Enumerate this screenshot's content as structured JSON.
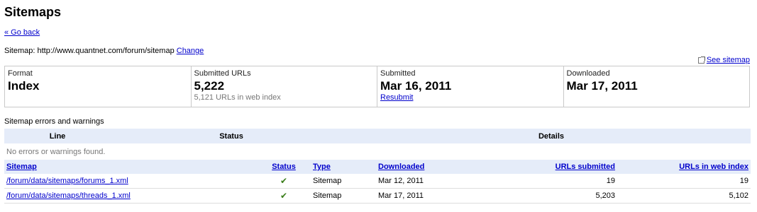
{
  "page": {
    "title": "Sitemaps",
    "go_back": "« Go back",
    "sitemap_label": "Sitemap:",
    "sitemap_url": "http://www.quantnet.com/forum/sitemap",
    "change_link": "Change",
    "see_sitemap": "See sitemap"
  },
  "summary": {
    "format_label": "Format",
    "format_value": "Index",
    "submitted_urls_label": "Submitted URLs",
    "submitted_urls_value": "5,222",
    "urls_in_index": "5,121 URLs in web index",
    "submitted_label": "Submitted",
    "submitted_value": "Mar 16, 2011",
    "resubmit": "Resubmit",
    "downloaded_label": "Downloaded",
    "downloaded_value": "Mar 17, 2011"
  },
  "errors": {
    "heading": "Sitemap errors and warnings",
    "col_line": "Line",
    "col_status": "Status",
    "col_details": "Details",
    "empty": "No errors or warnings found."
  },
  "table": {
    "headers": {
      "sitemap": "Sitemap",
      "status": "Status",
      "type": "Type",
      "downloaded": "Downloaded",
      "urls_submitted": "URLs submitted",
      "urls_in_index": "URLs in web index"
    },
    "rows": [
      {
        "sitemap": "/forum/data/sitemaps/forums_1.xml",
        "status_icon": "check-icon",
        "type": "Sitemap",
        "downloaded": "Mar 12, 2011",
        "urls_submitted": "19",
        "urls_in_index": "19"
      },
      {
        "sitemap": "/forum/data/sitemaps/threads_1.xml",
        "status_icon": "check-icon",
        "type": "Sitemap",
        "downloaded": "Mar 17, 2011",
        "urls_submitted": "5,203",
        "urls_in_index": "5,102"
      }
    ]
  }
}
